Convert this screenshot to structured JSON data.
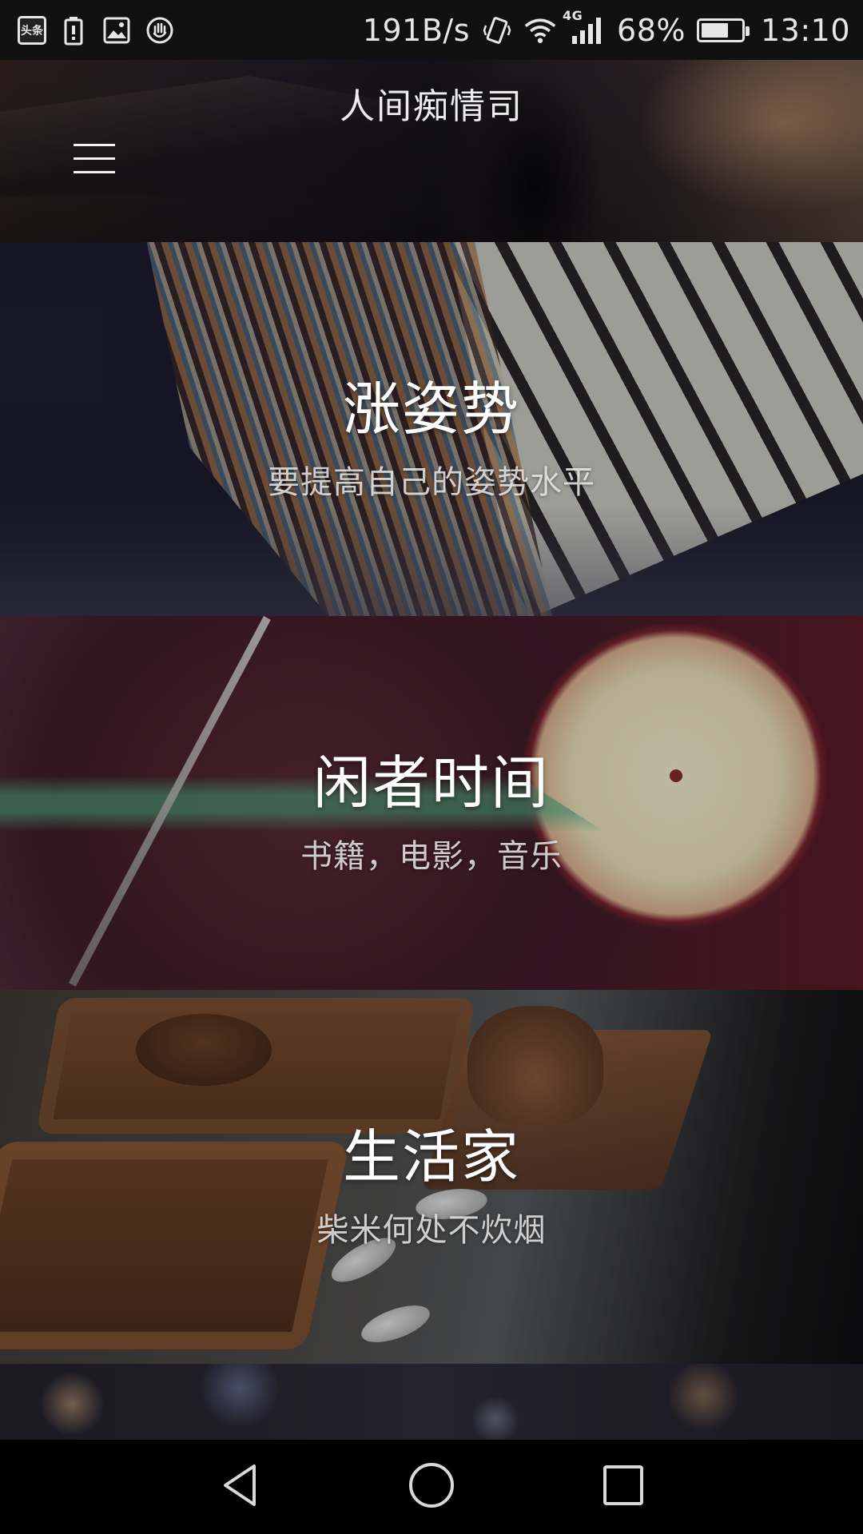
{
  "status_bar": {
    "badge_text": "头条",
    "network_speed": "191B/s",
    "network_type": "4G",
    "battery_percent": "68%",
    "battery_level": 0.68,
    "time": "13:10",
    "icons": [
      "toutiao-icon",
      "battery-warning-icon",
      "image-icon",
      "hand-icon",
      "vibrate-icon",
      "wifi-icon",
      "cellular-signal-icon",
      "battery-icon"
    ]
  },
  "header": {
    "app_title": "人间痴情司",
    "menu_icon": "hamburger-menu-icon"
  },
  "categories": [
    {
      "title": "涨姿势",
      "subtitle": "要提高自己的姿势水平"
    },
    {
      "title": "闲者时间",
      "subtitle": "书籍，电影，音乐"
    },
    {
      "title": "生活家",
      "subtitle": "柴米何处不炊烟"
    }
  ],
  "nav_bar": {
    "icons": [
      "back-icon",
      "home-icon",
      "recent-apps-icon"
    ]
  },
  "colors": {
    "status_bar_bg": "#111111",
    "nav_bar_bg": "#000000",
    "title_text": "#ffffff",
    "subtitle_text": "#ebebeb"
  }
}
